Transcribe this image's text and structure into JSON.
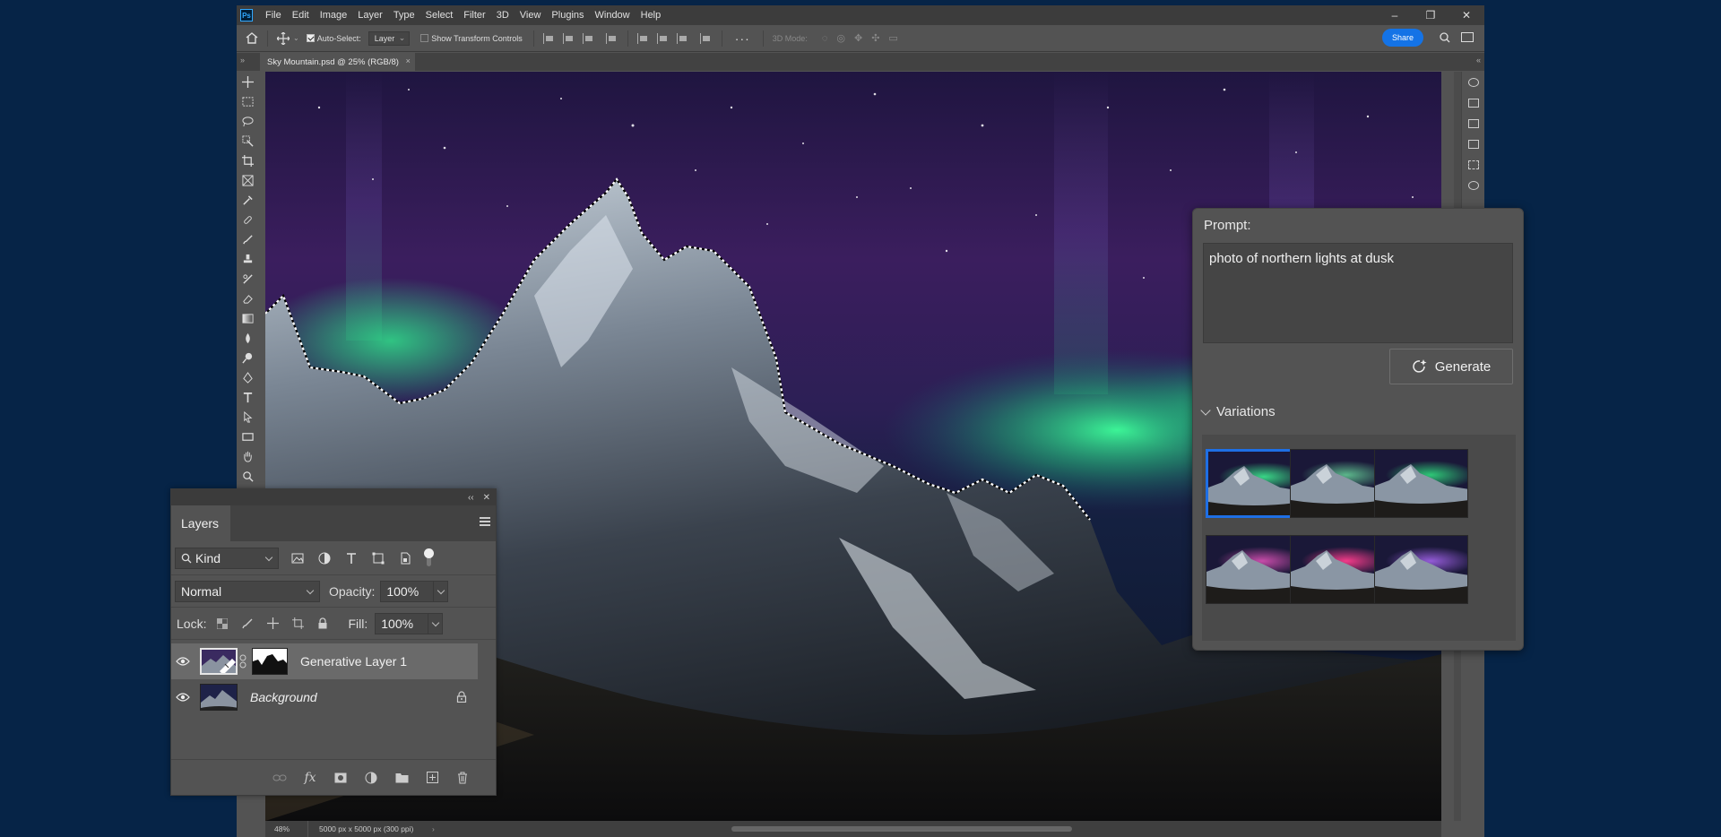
{
  "menu": {
    "logo": "Ps",
    "items": [
      "File",
      "Edit",
      "Image",
      "Layer",
      "Type",
      "Select",
      "Filter",
      "3D",
      "View",
      "Plugins",
      "Window",
      "Help"
    ]
  },
  "window_controls": {
    "minimize": "–",
    "restore": "❐",
    "close": "✕"
  },
  "options": {
    "auto_select_label": "Auto-Select:",
    "auto_select_value": "Layer",
    "show_transform_label": "Show Transform Controls",
    "mode_3d_label": "3D Mode:",
    "share_label": "Share"
  },
  "document": {
    "tab_title": "Sky Mountain.psd @ 25% (RGB/8)",
    "tab_close": "×"
  },
  "status": {
    "zoom": "48%",
    "doc_size": "5000 px x 5000 px (300 ppi)",
    "arrow": "›"
  },
  "layers_panel": {
    "tab_label": "Layers",
    "filter_kind": "Kind",
    "blend_mode": "Normal",
    "opacity_label": "Opacity:",
    "opacity_value": "100%",
    "lock_label": "Lock:",
    "fill_label": "Fill:",
    "fill_value": "100%",
    "layers": [
      {
        "name": "Generative Layer 1",
        "selected": true
      },
      {
        "name": "Background",
        "selected": false
      }
    ]
  },
  "gen_panel": {
    "prompt_label": "Prompt:",
    "prompt_text": "photo of northern lights at dusk",
    "generate_label": "Generate",
    "variations_label": "Variations",
    "variations": [
      {
        "aurora": "#3be08a",
        "selected": true
      },
      {
        "aurora": "#5fbf8f",
        "selected": false
      },
      {
        "aurora": "#2fd17a",
        "selected": false
      },
      {
        "aurora": "#d14fb0",
        "selected": false
      },
      {
        "aurora": "#ff3d8e",
        "selected": false
      },
      {
        "aurora": "#9a5fe0",
        "selected": false
      }
    ]
  }
}
